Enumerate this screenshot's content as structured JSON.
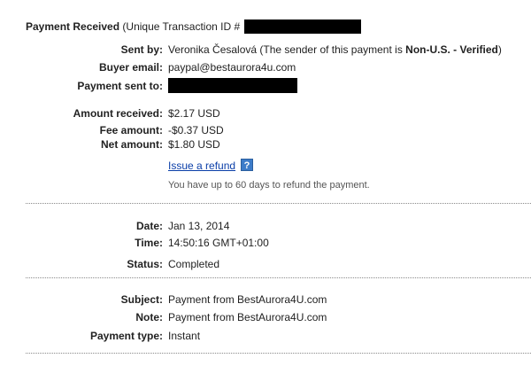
{
  "header": {
    "title": "Payment Received",
    "transaction_prefix": "(Unique Transaction ID #"
  },
  "buyer": {
    "sent_by_label": "Sent by:",
    "sent_by_name": "Veronika Česalová",
    "sent_by_note_prefix": "(The sender of this payment is ",
    "sent_by_status": "Non-U.S. - Verified",
    "sent_by_note_suffix": ")",
    "email_label": "Buyer email:",
    "email_value": "paypal@bestaurora4u.com",
    "sent_to_label": "Payment sent to:"
  },
  "amounts": {
    "received_label": "Amount received:",
    "received_value": "$2.17 USD",
    "fee_label": "Fee amount:",
    "fee_value": "-$0.37 USD",
    "net_label": "Net amount:",
    "net_value": "$1.80 USD",
    "refund_link": "Issue a refund",
    "refund_help_glyph": "?",
    "refund_note": "You have up to 60 days to refund the payment."
  },
  "timing": {
    "date_label": "Date:",
    "date_value": "Jan 13, 2014",
    "time_label": "Time:",
    "time_value": "14:50:16 GMT+01:00",
    "status_label": "Status:",
    "status_value": "Completed"
  },
  "details": {
    "subject_label": "Subject:",
    "subject_value": "Payment from BestAurora4U.com",
    "note_label": "Note:",
    "note_value": "Payment from BestAurora4U.com",
    "type_label": "Payment type:",
    "type_value": "Instant"
  },
  "icons": {
    "refund_help": "help-question-icon"
  }
}
